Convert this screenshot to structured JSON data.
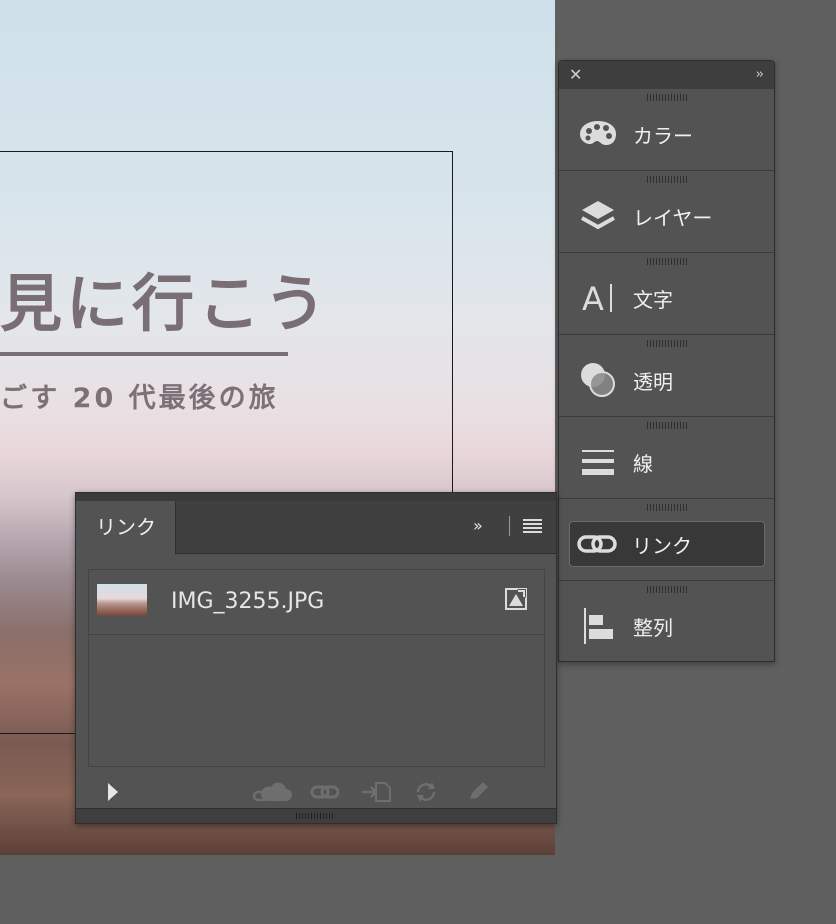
{
  "canvas": {
    "headline": "見に行こう",
    "subline": "ごす 20 代最後の旅"
  },
  "dock": {
    "close_icon": "close-icon",
    "expand_icon": "double-chevron-right-icon",
    "items": [
      {
        "label": "カラー",
        "icon": "palette-icon"
      },
      {
        "label": "レイヤー",
        "icon": "layers-icon"
      },
      {
        "label": "文字",
        "icon": "type-icon"
      },
      {
        "label": "透明",
        "icon": "transparency-icon"
      },
      {
        "label": "線",
        "icon": "stroke-icon"
      },
      {
        "label": "リンク",
        "icon": "link-icon",
        "active": true
      },
      {
        "label": "整列",
        "icon": "align-icon"
      }
    ]
  },
  "links_panel": {
    "tab_label": "リンク",
    "items": [
      {
        "name": "IMG_3255.JPG",
        "status_icon": "embedded-status-icon"
      }
    ],
    "footer_icons": [
      "expand-triangle-icon",
      "cc-library-link-icon",
      "relink-icon",
      "go-to-link-icon",
      "update-link-icon",
      "edit-original-icon"
    ]
  },
  "colors": {
    "ui_background": "#5f5f5f",
    "panel": "#535353",
    "panel_header": "#404040",
    "headline_text": "#7a6e75"
  }
}
